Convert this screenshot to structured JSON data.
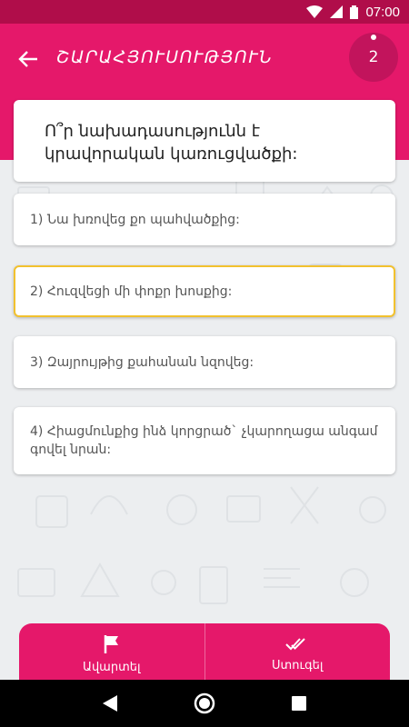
{
  "status_bar": {
    "time": "07:00"
  },
  "header": {
    "title": "ՇԱՐԱՀՅՈՒՍՈՒԹՅՈՒՆ",
    "counter": "2"
  },
  "question": {
    "text": "Ո՞ր նախադասությունն է կրավորական կառուցվածքի:"
  },
  "answers": [
    {
      "text": "1) Նա խռովեց քո պահվածքից:",
      "selected": false
    },
    {
      "text": "2) Հուզվեցի մի փոքր խոսքից:",
      "selected": true
    },
    {
      "text": "3) Զայրույթից քահանան նզովեց:",
      "selected": false
    },
    {
      "text": "4) Հիացմունքից ինձ կորցրած` չկարողացա անգամ գովել նրան:",
      "selected": false
    }
  ],
  "bottom_bar": {
    "finish_label": "Ավարտել",
    "check_label": "Ստուգել"
  },
  "colors": {
    "primary": "#e5186a",
    "status": "#b00d4a",
    "highlight": "#f2c12e"
  },
  "icons": {
    "back": "arrow-left-icon",
    "finish": "flag-icon",
    "check": "double-check-icon"
  }
}
